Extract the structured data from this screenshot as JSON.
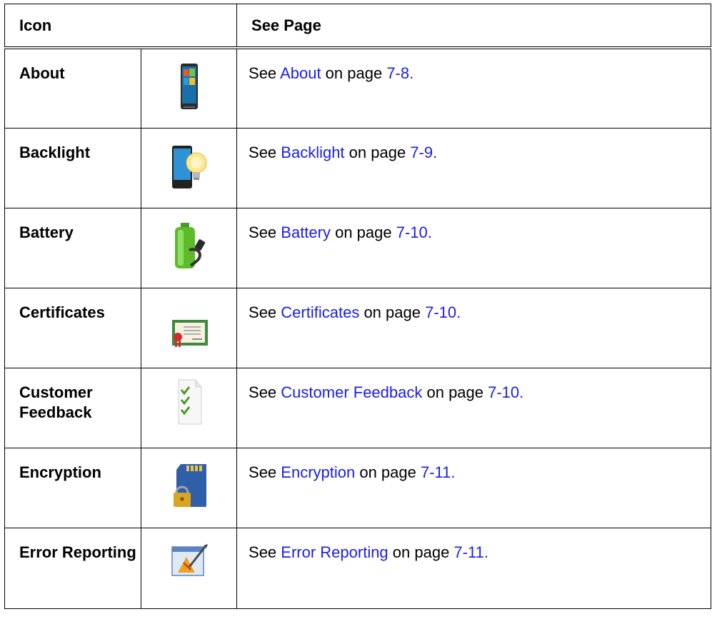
{
  "header": {
    "icon_col": "Icon",
    "page_col": "See Page"
  },
  "rows": [
    {
      "name": "About",
      "icon": "phone-windows-icon",
      "see": "See ",
      "link": "About",
      "on": " on page ",
      "page": "7-8."
    },
    {
      "name": "Backlight",
      "icon": "phone-lightbulb-icon",
      "see": "See ",
      "link": "Backlight",
      "on": " on page ",
      "page": "7-9."
    },
    {
      "name": "Battery",
      "icon": "battery-plug-icon",
      "see": "See ",
      "link": "Battery",
      "on": " on page ",
      "page": "7-10."
    },
    {
      "name": "Certificates",
      "icon": "certificate-icon",
      "see": "See ",
      "link": "Certificates",
      "on": " on page ",
      "page": "7-10."
    },
    {
      "name": "Customer Feedback",
      "icon": "checklist-document-icon",
      "see": "See ",
      "link": "Customer Feedback",
      "on": " on page ",
      "page": "7-10."
    },
    {
      "name": "Encryption",
      "icon": "sd-card-lock-icon",
      "see": "See ",
      "link": "Encryption",
      "on": " on page ",
      "page": "7-11."
    },
    {
      "name": "Error Reporting",
      "icon": "error-report-window-icon",
      "see": "See ",
      "link": "Error Reporting",
      "on": " on page ",
      "page": "7-11."
    }
  ],
  "colors": {
    "link": "#1a1ee6",
    "border": "#000000"
  }
}
